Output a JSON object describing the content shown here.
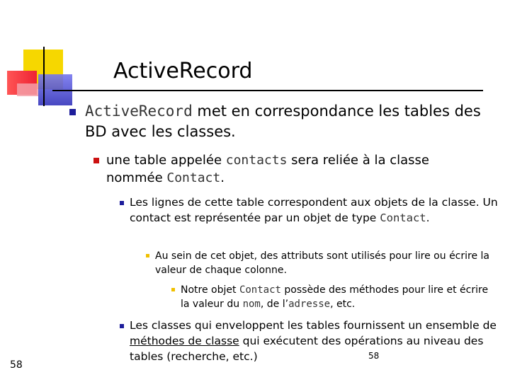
{
  "title": "ActiveRecord",
  "l1": {
    "code": "ActiveRecord",
    "text": " met en correspondance les tables des BD avec les classes."
  },
  "l2": {
    "t1": "une table appelée ",
    "c1": "contacts",
    "t2": " sera reliée à la classe nommée ",
    "c2": "Contact",
    "t3": "."
  },
  "l3a": {
    "t1": "Les lignes de cette table correspondent aux objets de la classe. Un contact est représentée par un objet de type ",
    "c1": "Contact",
    "t2": "."
  },
  "l4": {
    "t1": "Au sein de cet objet, des attributs sont utilisés pour lire ou écrire la valeur de chaque colonne."
  },
  "l5": {
    "t1": "Notre objet ",
    "c1": "Contact",
    "t2": " possède des méthodes pour lire et écrire la valeur du ",
    "c2": "nom",
    "t3": ", de l’",
    "c3": "adresse",
    "t4": ", etc."
  },
  "l3b": {
    "t1": "Les classes qui enveloppent les tables fournissent un ensemble de ",
    "link": "méthodes de classe",
    "t2": " qui exécutent des opérations au niveau des tables (recherche, etc.)"
  },
  "page_left": "58",
  "page_mid": "58",
  "colors": {
    "bullet_l1": "#1d1d9b",
    "bullet_l2": "#cc1111",
    "bullet_l4": "#f0c000"
  }
}
